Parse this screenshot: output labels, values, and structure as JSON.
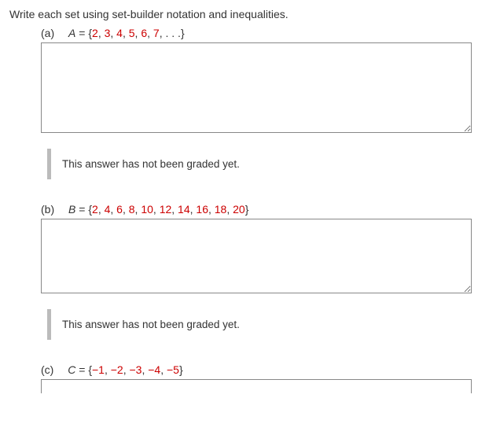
{
  "stem": "Write each set using set-builder notation and inequalities.",
  "parts": {
    "a": {
      "label": "(a)",
      "var": "A",
      "eq": " = ",
      "open": "{",
      "nums": [
        "2",
        "3",
        "4",
        "5",
        "6",
        "7"
      ],
      "sep": ", ",
      "tail": ", . . .",
      "close": "}",
      "grading": "This answer has not been graded yet."
    },
    "b": {
      "label": "(b)",
      "var": "B",
      "eq": " = ",
      "open": "{",
      "nums": [
        "2",
        "4",
        "6",
        "8",
        "10",
        "12",
        "14",
        "16",
        "18",
        "20"
      ],
      "sep": ", ",
      "tail": "",
      "close": "}",
      "grading": "This answer has not been graded yet."
    },
    "c": {
      "label": "(c)",
      "var": "C",
      "eq": " = ",
      "open": "{",
      "nums": [
        "−1",
        "−2",
        "−3",
        "−4",
        "−5"
      ],
      "sep": ", ",
      "tail": "",
      "close": "}"
    }
  }
}
